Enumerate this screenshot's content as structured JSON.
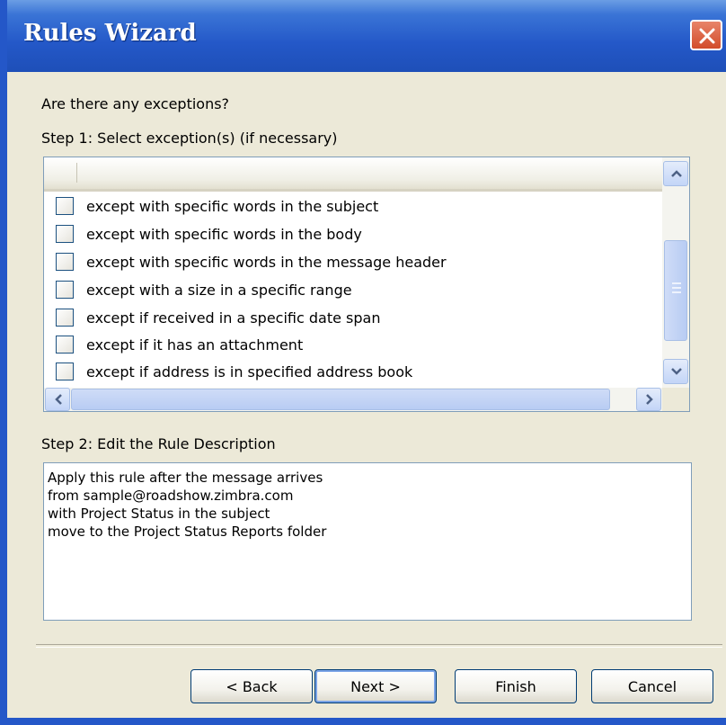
{
  "window": {
    "title": "Rules Wizard"
  },
  "prompt": "Are there any exceptions?",
  "step1": {
    "label": "Step 1: Select exception(s) (if necessary)",
    "items": [
      {
        "label": "except with specific words in the subject",
        "checked": false
      },
      {
        "label": "except with specific words in the body",
        "checked": false
      },
      {
        "label": "except with specific words in the message header",
        "checked": false
      },
      {
        "label": "except with a size in a specific range",
        "checked": false
      },
      {
        "label": "except if received in a specific date span",
        "checked": false
      },
      {
        "label": "except if it has an attachment",
        "checked": false
      },
      {
        "label": "except if address is in specified address book",
        "checked": false
      }
    ]
  },
  "step2": {
    "label": "Step 2: Edit the Rule Description",
    "lines": [
      "Apply this rule after the message arrives",
      "from sample@roadshow.zimbra.com",
      "with Project Status in the subject",
      "move to the Project Status Reports folder"
    ]
  },
  "buttons": {
    "back": "< Back",
    "next": "Next >",
    "finish": "Finish",
    "cancel": "Cancel"
  },
  "colors": {
    "titlebar": "#2458c8",
    "dialog_bg": "#ece9d8",
    "close_button": "#d24c2a"
  }
}
